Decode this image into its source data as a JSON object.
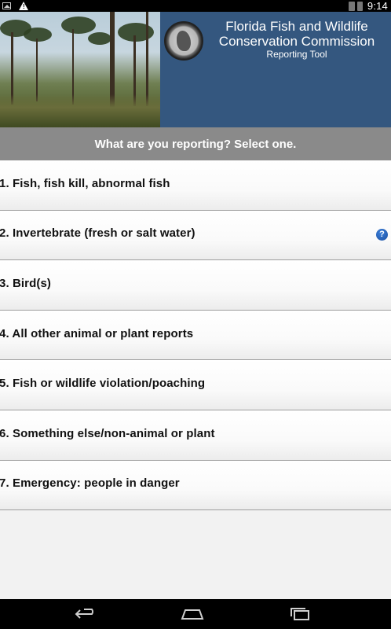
{
  "status_bar": {
    "time": "9:14",
    "icons": [
      "image-notification-icon",
      "warning-icon",
      "wifi-icon",
      "battery-icon"
    ]
  },
  "header": {
    "org_name": "Florida Fish and Wildlife Conservation Commission",
    "subtitle": "Reporting Tool",
    "colors": {
      "title_bg": "#34577f"
    }
  },
  "prompt": "What are you reporting? Select one.",
  "report_options": [
    {
      "label": "1. Fish, fish kill, abnormal fish",
      "has_help": false
    },
    {
      "label": "2. Invertebrate (fresh or salt water)",
      "has_help": true
    },
    {
      "label": "3. Bird(s)",
      "has_help": false
    },
    {
      "label": "4. All other animal or plant reports",
      "has_help": false
    },
    {
      "label": "5. Fish or wildlife violation/poaching",
      "has_help": false
    },
    {
      "label": "6. Something else/non-animal or plant",
      "has_help": false
    },
    {
      "label": "7. Emergency: people in danger",
      "has_help": false
    }
  ],
  "help_icon_label": "?",
  "nav_bar": {
    "buttons": [
      "back-icon",
      "home-icon",
      "recents-icon"
    ]
  }
}
